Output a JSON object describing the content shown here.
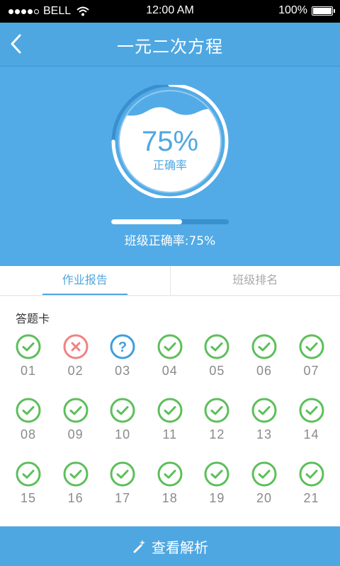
{
  "status": {
    "carrier": "BELL",
    "time": "12:00 AM",
    "battery": "100%"
  },
  "header": {
    "title": "一元二次方程"
  },
  "summary": {
    "percent_text": "75%",
    "percent_label": "正确率",
    "accuracy": 0.75,
    "class_rate_text": "班级正确率:75%",
    "class_accuracy": 0.6
  },
  "tabs": [
    {
      "label": "作业报告",
      "active": true
    },
    {
      "label": "班级排名",
      "active": false
    }
  ],
  "card": {
    "title": "答题卡",
    "questions": [
      {
        "num": "01",
        "status": "correct"
      },
      {
        "num": "02",
        "status": "wrong"
      },
      {
        "num": "03",
        "status": "unknown"
      },
      {
        "num": "04",
        "status": "correct"
      },
      {
        "num": "05",
        "status": "correct"
      },
      {
        "num": "06",
        "status": "correct"
      },
      {
        "num": "07",
        "status": "correct"
      },
      {
        "num": "08",
        "status": "correct"
      },
      {
        "num": "09",
        "status": "correct"
      },
      {
        "num": "10",
        "status": "correct"
      },
      {
        "num": "11",
        "status": "correct"
      },
      {
        "num": "12",
        "status": "correct"
      },
      {
        "num": "13",
        "status": "correct"
      },
      {
        "num": "14",
        "status": "correct"
      },
      {
        "num": "15",
        "status": "correct"
      },
      {
        "num": "16",
        "status": "correct"
      },
      {
        "num": "17",
        "status": "correct"
      },
      {
        "num": "18",
        "status": "correct"
      },
      {
        "num": "19",
        "status": "correct"
      },
      {
        "num": "20",
        "status": "correct"
      },
      {
        "num": "21",
        "status": "correct"
      }
    ]
  },
  "footer": {
    "label": "查看解析",
    "icon": "magic-wand-icon"
  },
  "colors": {
    "primary": "#4fa7e2",
    "correct": "#5cbf5a",
    "wrong": "#f08282",
    "unknown": "#3d9ee0"
  }
}
